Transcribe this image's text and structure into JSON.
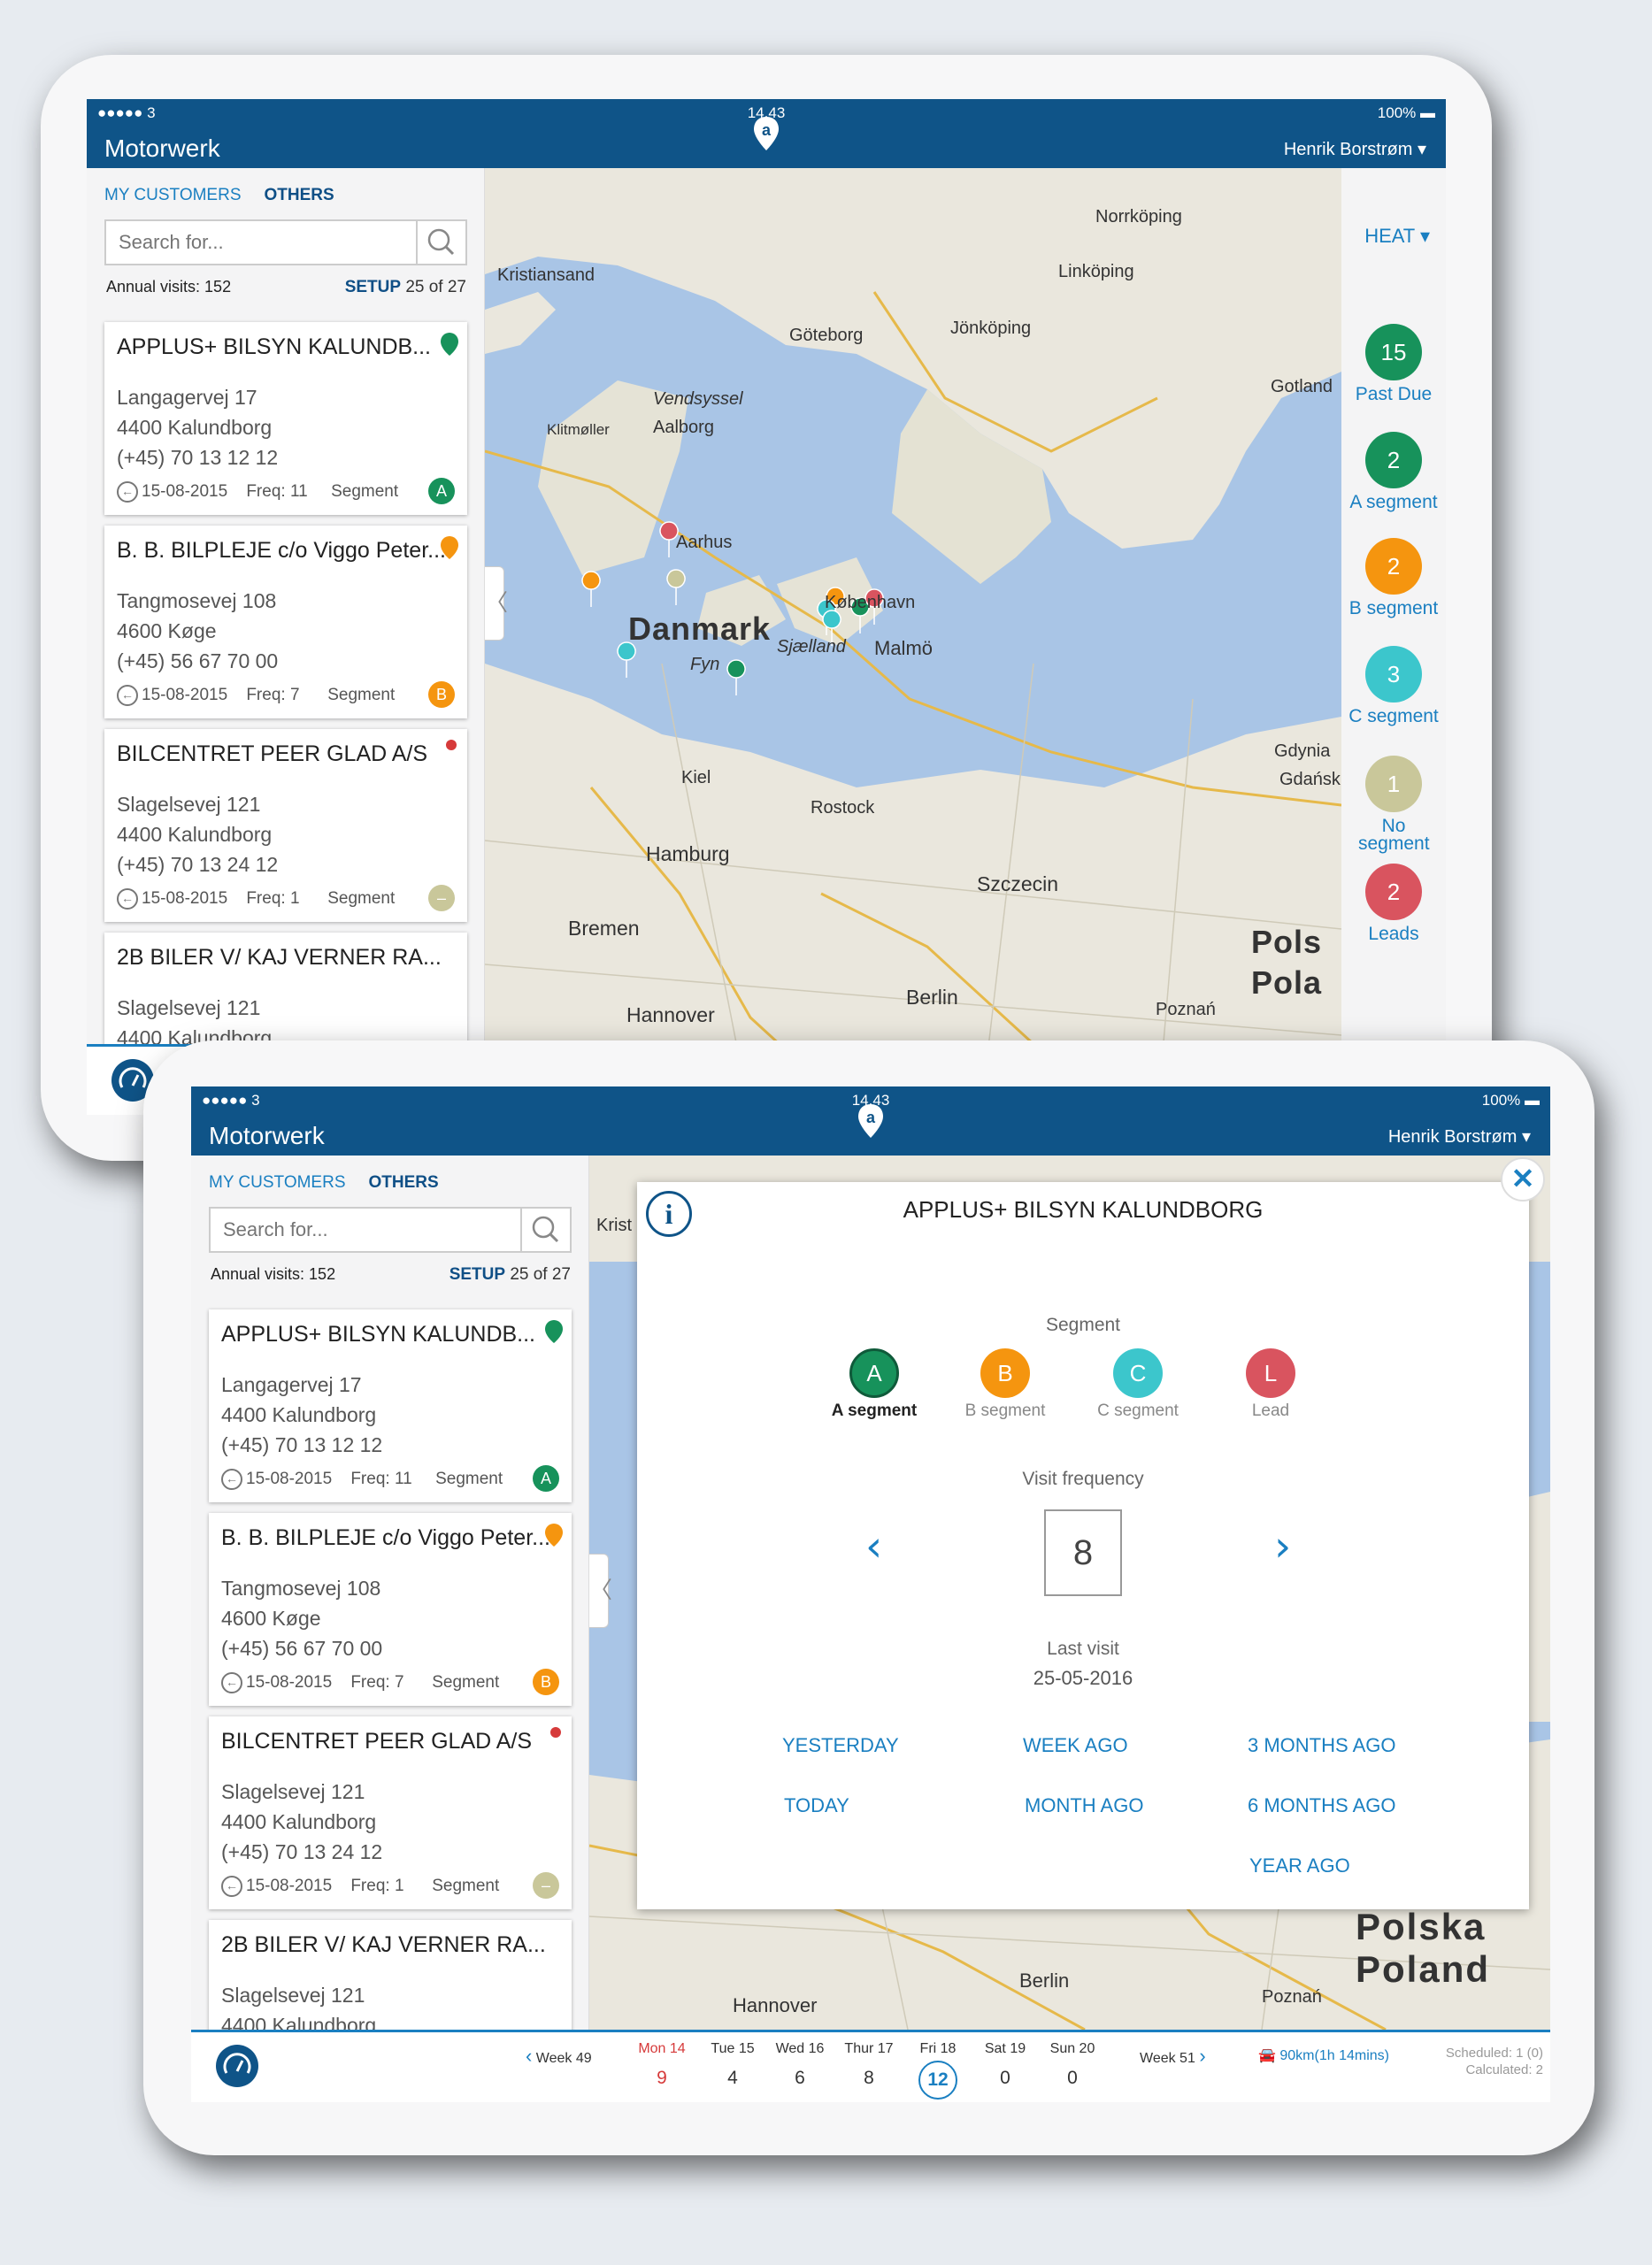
{
  "status_bar": {
    "signal": "●●●●● 3",
    "time": "14.43",
    "battery": "100%"
  },
  "app": {
    "title": "Motorwerk",
    "user": "Henrik Borstrøm ▾"
  },
  "tabs": {
    "mine": "MY CUSTOMERS",
    "others": "OTHERS"
  },
  "search": {
    "placeholder": "Search for..."
  },
  "annual_visits": "Annual visits: 152",
  "setup": {
    "label": "SETUP",
    "value": "25 of 27"
  },
  "customers": [
    {
      "name": "APPLUS+ BILSYN KALUNDB...",
      "address": "Langagervej 17",
      "city": "4400 Kalundborg",
      "phone": "(+45) 70 13 12 12",
      "date": "15-08-2015",
      "freq": "Freq: 11",
      "segment_label": "Segment",
      "segment": "A",
      "color": "#17925b"
    },
    {
      "name": "B. B. BILPLEJE c/o Viggo Peter...",
      "address": "Tangmosevej 108",
      "city": "4600 Køge",
      "phone": "(+45) 56 67 70 00",
      "date": "15-08-2015",
      "freq": "Freq: 7",
      "segment_label": "Segment",
      "segment": "B",
      "color": "#f5950f"
    },
    {
      "name": "BILCENTRET PEER GLAD A/S",
      "address": "Slagelsevej 121",
      "city": "4400 Kalundborg",
      "phone": "(+45) 70 13 24 12",
      "date": "15-08-2015",
      "freq": "Freq: 1",
      "segment_label": "Segment",
      "segment": "–",
      "color": "#c9c79a"
    },
    {
      "name": "2B BILER V/ KAJ VERNER RA...",
      "address": "Slagelsevej 121",
      "city": "4400 Kalundborg",
      "phone": "",
      "date": "",
      "freq": "",
      "segment_label": "",
      "segment": "",
      "color": "#ffffff"
    }
  ],
  "heat": {
    "label": "HEAT ▾",
    "items": [
      {
        "count": "15",
        "label": "Past Due",
        "color": "#17925b"
      },
      {
        "count": "2",
        "label": "A segment",
        "color": "#17925b"
      },
      {
        "count": "2",
        "label": "B segment",
        "color": "#f5950f"
      },
      {
        "count": "3",
        "label": "C segment",
        "color": "#3cc6cc"
      },
      {
        "count": "1",
        "label": "No segment",
        "color": "#c9c79a"
      },
      {
        "count": "2",
        "label": "Leads",
        "color": "#d9545f"
      }
    ]
  },
  "map_labels": [
    "Norrköping",
    "Kristiansand",
    "Linköping",
    "Göteborg",
    "Jönköping",
    "Gotland",
    "Vendsyssel",
    "Klitmøller",
    "Aalborg",
    "Aarhus",
    "København",
    "Danmark",
    "Sjælland",
    "Malmö",
    "Fyn",
    "Gdynia",
    "Gdańsk",
    "Kiel",
    "Rostock",
    "Hamburg",
    "Szczecin",
    "Bremen",
    "Pols",
    "Pola",
    "Hannover",
    "Berlin",
    "Poznań",
    "Krist",
    "Polska",
    "Poland"
  ],
  "modal": {
    "title": "APPLUS+ BILSYN KALUNDBORG",
    "segment_label": "Segment",
    "segments": [
      {
        "letter": "A",
        "label": "A segment",
        "color": "#17925b"
      },
      {
        "letter": "B",
        "label": "B segment",
        "color": "#f5950f"
      },
      {
        "letter": "C",
        "label": "C segment",
        "color": "#3cc6cc"
      },
      {
        "letter": "L",
        "label": "Lead",
        "color": "#d9545f"
      }
    ],
    "visit_frequency_label": "Visit frequency",
    "visit_frequency": "8",
    "last_visit_label": "Last visit",
    "last_visit": "25-05-2016",
    "quick": [
      "YESTERDAY",
      "WEEK AGO",
      "3 MONTHS AGO",
      "TODAY",
      "MONTH AGO",
      "6 MONTHS AGO",
      "YEAR AGO"
    ]
  },
  "calendar": {
    "prev_week": "Week 49",
    "next_week": "Week 51",
    "days": [
      {
        "name": "Mon 14",
        "count": "9"
      },
      {
        "name": "Tue 15",
        "count": "4"
      },
      {
        "name": "Wed 16",
        "count": "6"
      },
      {
        "name": "Thur 17",
        "count": "8"
      },
      {
        "name": "Fri 18",
        "count": "12"
      },
      {
        "name": "Sat 19",
        "count": "0"
      },
      {
        "name": "Sun 20",
        "count": "0"
      }
    ],
    "route": "90km(1h 14mins)",
    "scheduled": "Scheduled: 1 (0)",
    "calculated": "Calculated: 2"
  }
}
